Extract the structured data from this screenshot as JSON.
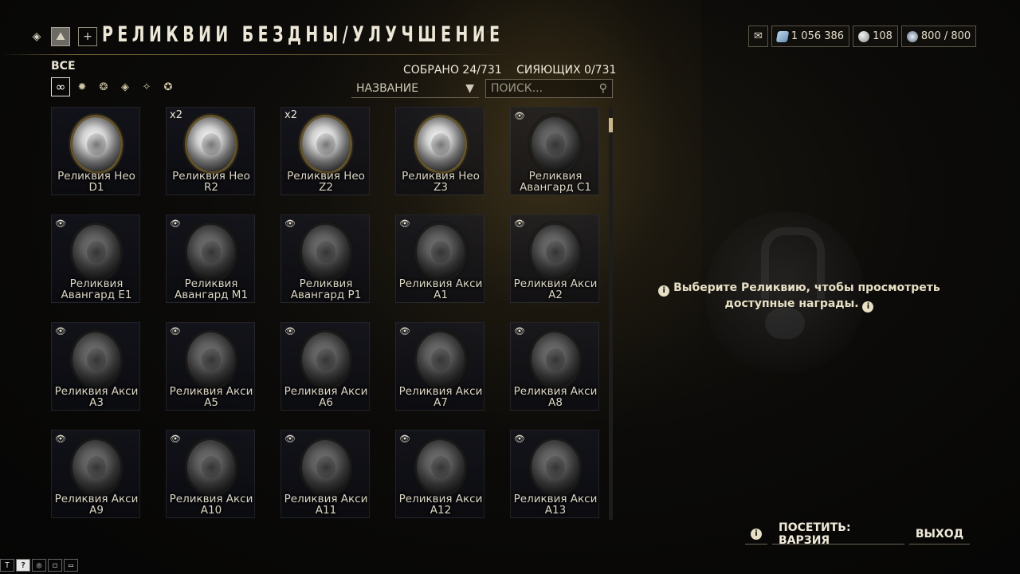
{
  "header": {
    "title": "РЕЛИКВИИ БЕЗДНЫ/УЛУЧШЕНИЕ",
    "plus_label": "+"
  },
  "currencies": {
    "platinum": "1 056 386",
    "credits": "108",
    "endo": "800 / 800"
  },
  "filter": {
    "label": "ВСЕ",
    "icons": [
      "infinity-icon",
      "lith-icon",
      "meso-icon",
      "neo-icon",
      "axi-icon",
      "requiem-icon"
    ]
  },
  "counts": {
    "collected": "СОБРАНО 24/731",
    "radiant": "СИЯЮЩИХ 0/731"
  },
  "sort": {
    "label": "НАЗВАНИЕ"
  },
  "search": {
    "placeholder": "ПОИСК..."
  },
  "relics": [
    {
      "name": "Реликвия Нео",
      "tier": "D1",
      "qty": "",
      "eye": false
    },
    {
      "name": "Реликвия Нео",
      "tier": "R2",
      "qty": "x2",
      "eye": false
    },
    {
      "name": "Реликвия Нео",
      "tier": "Z2",
      "qty": "x2",
      "eye": false
    },
    {
      "name": "Реликвия Нео",
      "tier": "Z3",
      "qty": "",
      "eye": false
    },
    {
      "name": "Реликвия",
      "tier": "Авангард C1",
      "qty": "",
      "eye": true
    },
    {
      "name": "Реликвия",
      "tier": "Авангард E1",
      "qty": "",
      "eye": true
    },
    {
      "name": "Реликвия",
      "tier": "Авангард M1",
      "qty": "",
      "eye": true
    },
    {
      "name": "Реликвия",
      "tier": "Авангард P1",
      "qty": "",
      "eye": true
    },
    {
      "name": "Реликвия Акси",
      "tier": "A1",
      "qty": "",
      "eye": true
    },
    {
      "name": "Реликвия Акси",
      "tier": "A2",
      "qty": "",
      "eye": true
    },
    {
      "name": "Реликвия Акси",
      "tier": "A3",
      "qty": "",
      "eye": true
    },
    {
      "name": "Реликвия Акси",
      "tier": "A5",
      "qty": "",
      "eye": true
    },
    {
      "name": "Реликвия Акси",
      "tier": "A6",
      "qty": "",
      "eye": true
    },
    {
      "name": "Реликвия Акси",
      "tier": "A7",
      "qty": "",
      "eye": true
    },
    {
      "name": "Реликвия Акси",
      "tier": "A8",
      "qty": "",
      "eye": true
    },
    {
      "name": "Реликвия Акси",
      "tier": "A9",
      "qty": "",
      "eye": true
    },
    {
      "name": "Реликвия Акси",
      "tier": "A10",
      "qty": "",
      "eye": true
    },
    {
      "name": "Реликвия Акси",
      "tier": "A11",
      "qty": "",
      "eye": true
    },
    {
      "name": "Реликвия Акси",
      "tier": "A12",
      "qty": "",
      "eye": true
    },
    {
      "name": "Реликвия Акси",
      "tier": "A13",
      "qty": "",
      "eye": true
    }
  ],
  "right_panel": {
    "hint": "Выберите Реликвию, чтобы просмотреть доступные награды."
  },
  "bottom": {
    "visit_label": "ПОСЕТИТЬ: ВАРЗИЯ",
    "exit_label": "ВЫХОД"
  },
  "mini_toolbar": [
    "T",
    "?",
    "◎",
    "◻",
    "▭"
  ]
}
